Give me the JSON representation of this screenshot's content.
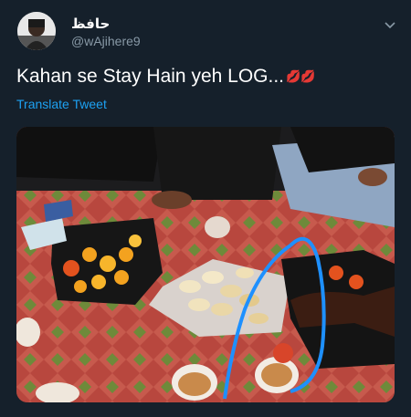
{
  "header": {
    "display_name": "حافظ",
    "handle": "@wAjihere9"
  },
  "tweet": {
    "text": "Kahan se Stay Hain yeh LOG...",
    "emoji": "💋💋",
    "translate_label": "Translate Tweet"
  },
  "colors": {
    "background": "#15202b",
    "text": "#ffffff",
    "secondary_text": "#8899a6",
    "link": "#1da1f2",
    "annotation_stroke": "#1e90ff"
  },
  "icons": {
    "menu": "chevron-down-icon"
  }
}
